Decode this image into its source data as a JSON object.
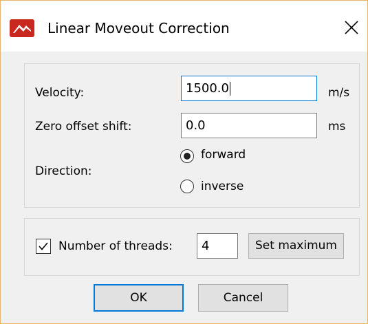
{
  "window": {
    "title": "Linear Moveout Correction",
    "icon": "app-logo-icon",
    "close_icon": "close-icon",
    "border_color": "#e8b46c"
  },
  "fields": {
    "velocity": {
      "label": "Velocity:",
      "value": "1500.0",
      "unit": "m/s"
    },
    "zero_offset_shift": {
      "label": "Zero offset shift:",
      "value": "0.0",
      "unit": "ms"
    }
  },
  "direction": {
    "label": "Direction:",
    "options": [
      {
        "label": "forward",
        "selected": true
      },
      {
        "label": "inverse",
        "selected": false
      }
    ]
  },
  "threads": {
    "checkbox_label": "Number of threads:",
    "checked": true,
    "value": "4",
    "set_max_label": "Set maximum"
  },
  "buttons": {
    "ok": "OK",
    "cancel": "Cancel"
  },
  "colors": {
    "accent": "#0078d7",
    "logo": "#c8281e"
  }
}
